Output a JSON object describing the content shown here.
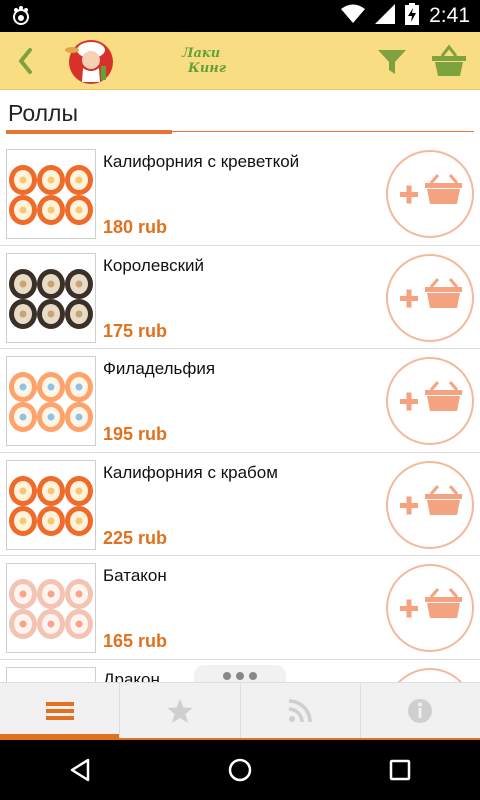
{
  "status_bar": {
    "time": "2:41",
    "icons": [
      "cat-paw-icon",
      "wifi-icon",
      "signal-icon",
      "battery-charging-icon"
    ]
  },
  "app_bar": {
    "logo_line1": "Лаки",
    "logo_line2": "Кинг",
    "icons": [
      "back-chevron-icon",
      "filter-icon",
      "basket-icon"
    ]
  },
  "section": {
    "title": "Роллы"
  },
  "items": [
    {
      "name": "Калифорния с креветкой",
      "price": "180 rub",
      "image": "roll-orange-caviar"
    },
    {
      "name": "Королевский",
      "price": "175 rub",
      "image": "roll-eel"
    },
    {
      "name": "Филадельфия",
      "price": "195 rub",
      "image": "roll-salmon"
    },
    {
      "name": "Калифорния с крабом",
      "price": "225 rub",
      "image": "roll-orange-caviar"
    },
    {
      "name": "Батакон",
      "price": "165 rub",
      "image": "roll-bacon"
    },
    {
      "name": "Дракон",
      "price": "",
      "image": "roll-dragon"
    }
  ],
  "tabs": [
    {
      "id": "menu",
      "icon": "menu-icon",
      "active": true
    },
    {
      "id": "favorites",
      "icon": "star-icon",
      "active": false
    },
    {
      "id": "news",
      "icon": "rss-icon",
      "active": false
    },
    {
      "id": "info",
      "icon": "info-icon",
      "active": false
    }
  ],
  "nav_bar": {
    "icons": [
      "back-triangle-icon",
      "home-circle-icon",
      "recents-square-icon"
    ]
  },
  "colors": {
    "accent": "#e0711f",
    "appbar": "#f9dd82",
    "green": "#63a23a",
    "add_button": "#f4a27f"
  }
}
